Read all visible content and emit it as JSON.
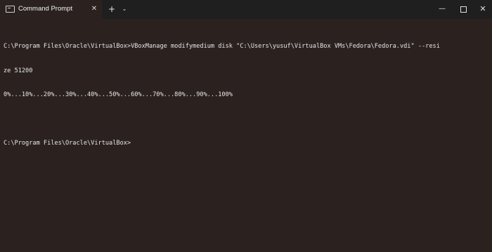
{
  "titlebar": {
    "tab_title": "Command Prompt",
    "tab_icon": "terminal-icon",
    "close_tab_glyph": "✕",
    "new_tab_glyph": "+",
    "tab_menu_glyph": "⌄",
    "minimize_glyph": "—",
    "close_window_glyph": "✕"
  },
  "console": {
    "lines": [
      "C:\\Program Files\\Oracle\\VirtualBox>VBoxManage modifymedium disk \"C:\\Users\\yusuf\\VirtualBox VMs\\Fedora\\Fedora.vdi\" --resi",
      "ze 51200",
      "0%...10%...20%...30%...40%...50%...60%...70%...80%...90%...100%",
      "",
      "C:\\Program Files\\Oracle\\VirtualBox>"
    ]
  },
  "colors": {
    "background": "#2b2220",
    "titlebar": "#1f1f1f",
    "text": "#e6e6e6"
  }
}
